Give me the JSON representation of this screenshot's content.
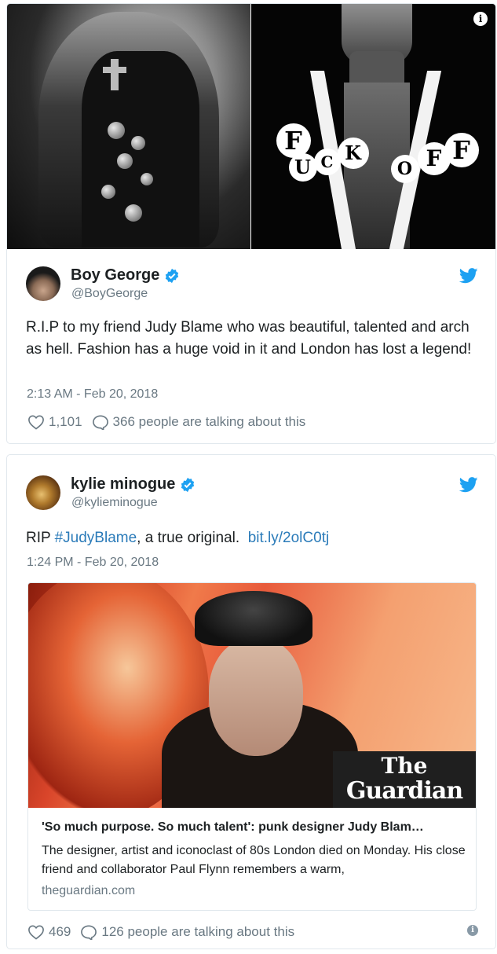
{
  "tweet1": {
    "media": {
      "left_image": "portrait with vest",
      "right_image": "portrait with badges",
      "badge_letters": [
        "F",
        "U",
        "C",
        "K",
        "O",
        "F",
        "F"
      ]
    },
    "author_name": "Boy George",
    "handle": "@BoyGeorge",
    "text": "R.I.P to my friend Judy Blame who was beautiful, talented and arch as hell. Fashion has a huge void in it and London has lost a legend!",
    "timestamp": "2:13 AM - Feb 20, 2018",
    "likes": "1,101",
    "talking": "366 people are talking about this"
  },
  "tweet2": {
    "author_name": "kylie minogue",
    "handle": "@kylieminogue",
    "text_prefix": "RIP ",
    "hashtag": "#JudyBlame",
    "text_middle": ", a true original.",
    "link": "bit.ly/2olC0tj",
    "timestamp": "1:24 PM - Feb 20, 2018",
    "card": {
      "logo_line1": "The",
      "logo_line2": "Guardian",
      "title": "'So much purpose. So much talent': punk designer Judy Blam…",
      "description": "The designer, artist and iconoclast of 80s London died on Monday. His close friend and collaborator Paul Flynn remembers a warm,",
      "domain": "theguardian.com"
    },
    "likes": "469",
    "talking": "126 people are talking about this"
  },
  "colors": {
    "twitter_blue": "#1da1f2",
    "link_blue": "#2b7bb9",
    "muted": "#697882",
    "border": "#e1e8ed"
  },
  "icons": [
    "info-icon",
    "verified-icon",
    "twitter-bird-icon",
    "heart-icon",
    "reply-icon"
  ]
}
